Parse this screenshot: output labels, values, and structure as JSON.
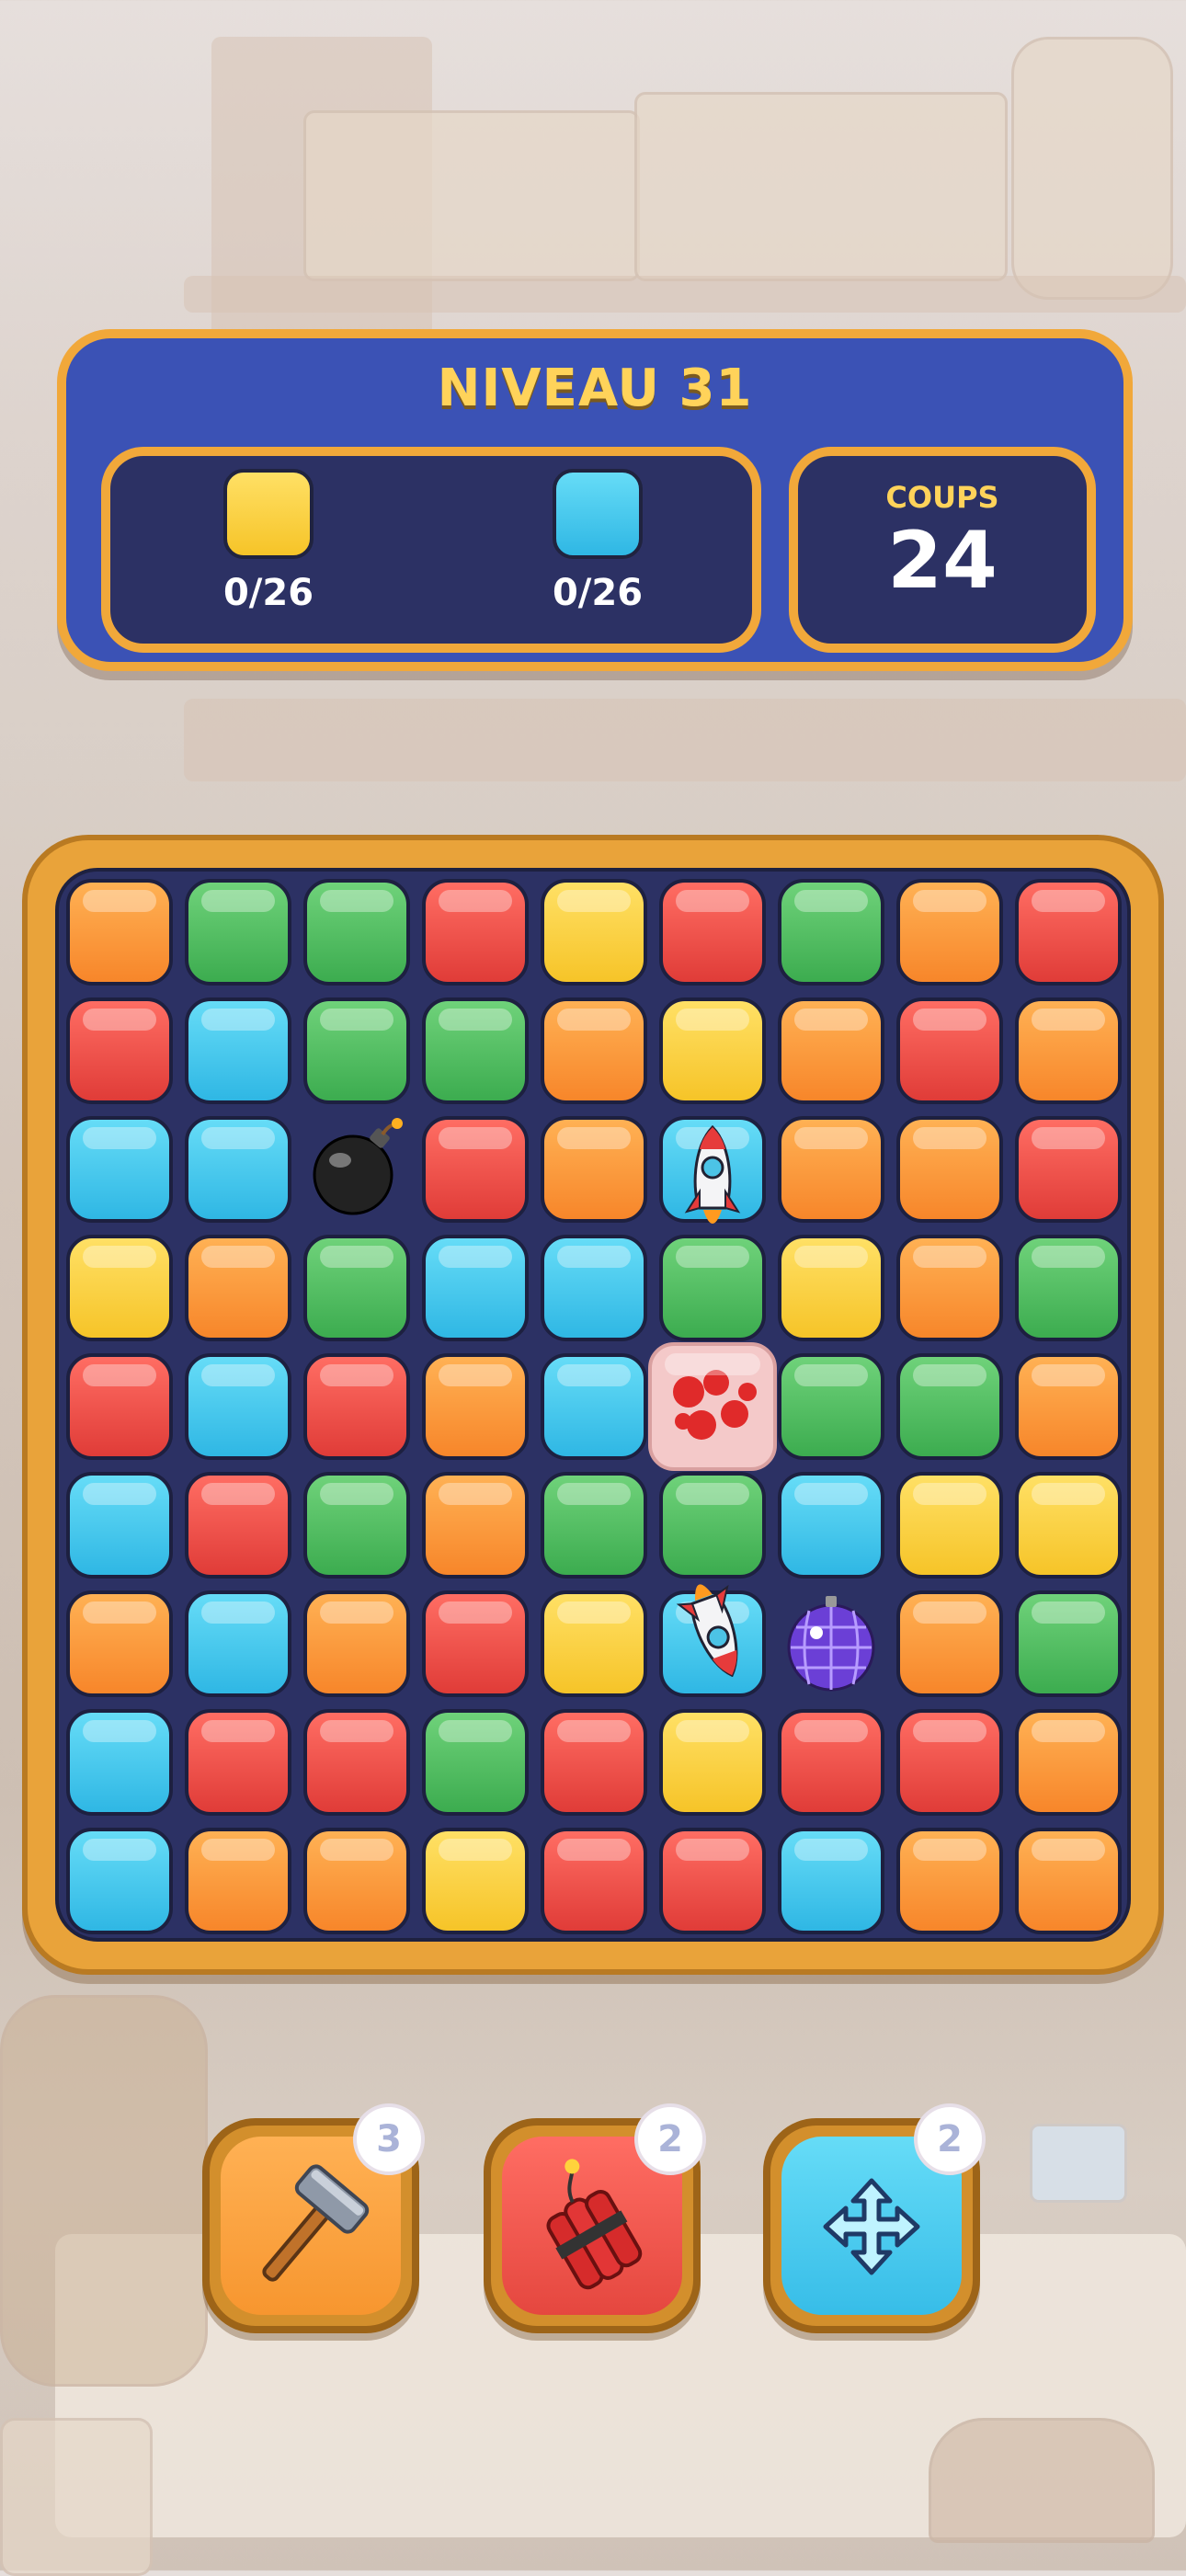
{
  "header": {
    "level_title": "NIVEAU 31",
    "goals": [
      {
        "color": "yellow",
        "count": "0/26"
      },
      {
        "color": "blue",
        "count": "0/26"
      }
    ],
    "moves_label": "COUPS",
    "moves_value": "24"
  },
  "board": {
    "rows": 9,
    "cols": 9,
    "grid": [
      [
        "orange",
        "green",
        "green",
        "red",
        "yellow",
        "red",
        "green",
        "orange",
        "red"
      ],
      [
        "red",
        "blue",
        "green",
        "green",
        "orange",
        "yellow",
        "orange",
        "red",
        "orange"
      ],
      [
        "blue",
        "blue",
        "bomb",
        "red",
        "orange",
        "rocket-up",
        "orange",
        "orange",
        "red"
      ],
      [
        "yellow",
        "orange",
        "green",
        "blue",
        "blue",
        "green-rocket-trail",
        "yellow",
        "orange",
        "green"
      ],
      [
        "red",
        "blue",
        "red",
        "orange",
        "blue",
        "red-splat",
        "green",
        "green",
        "orange"
      ],
      [
        "blue",
        "red",
        "green",
        "orange",
        "green",
        "green-rocket-trail",
        "blue",
        "yellow",
        "yellow"
      ],
      [
        "orange",
        "blue",
        "orange",
        "red",
        "yellow",
        "rocket-down",
        "disco-ball",
        "orange",
        "green"
      ],
      [
        "blue",
        "red",
        "red",
        "green",
        "red",
        "yellow",
        "red",
        "red",
        "orange"
      ],
      [
        "blue",
        "orange",
        "orange",
        "yellow",
        "red",
        "red",
        "blue",
        "orange",
        "orange"
      ]
    ],
    "special_icons": {
      "bomb": "bomb-icon",
      "rocket": "rocket-icon",
      "disco": "disco-ball-icon"
    }
  },
  "boosters": [
    {
      "icon": "hammer-icon",
      "count": "3",
      "color": "#f7962f"
    },
    {
      "icon": "dynamite-icon",
      "count": "2",
      "color": "#e5473f"
    },
    {
      "icon": "swap-arrows-icon",
      "count": "2",
      "color": "#37bde8"
    }
  ],
  "colors": {
    "orange": "#f7862a",
    "green": "#3cac4f",
    "red": "#e03c38",
    "yellow": "#f6c428",
    "blue": "#2fb7e4",
    "panel": "#3b52b5",
    "frame": "#f1a83a"
  }
}
